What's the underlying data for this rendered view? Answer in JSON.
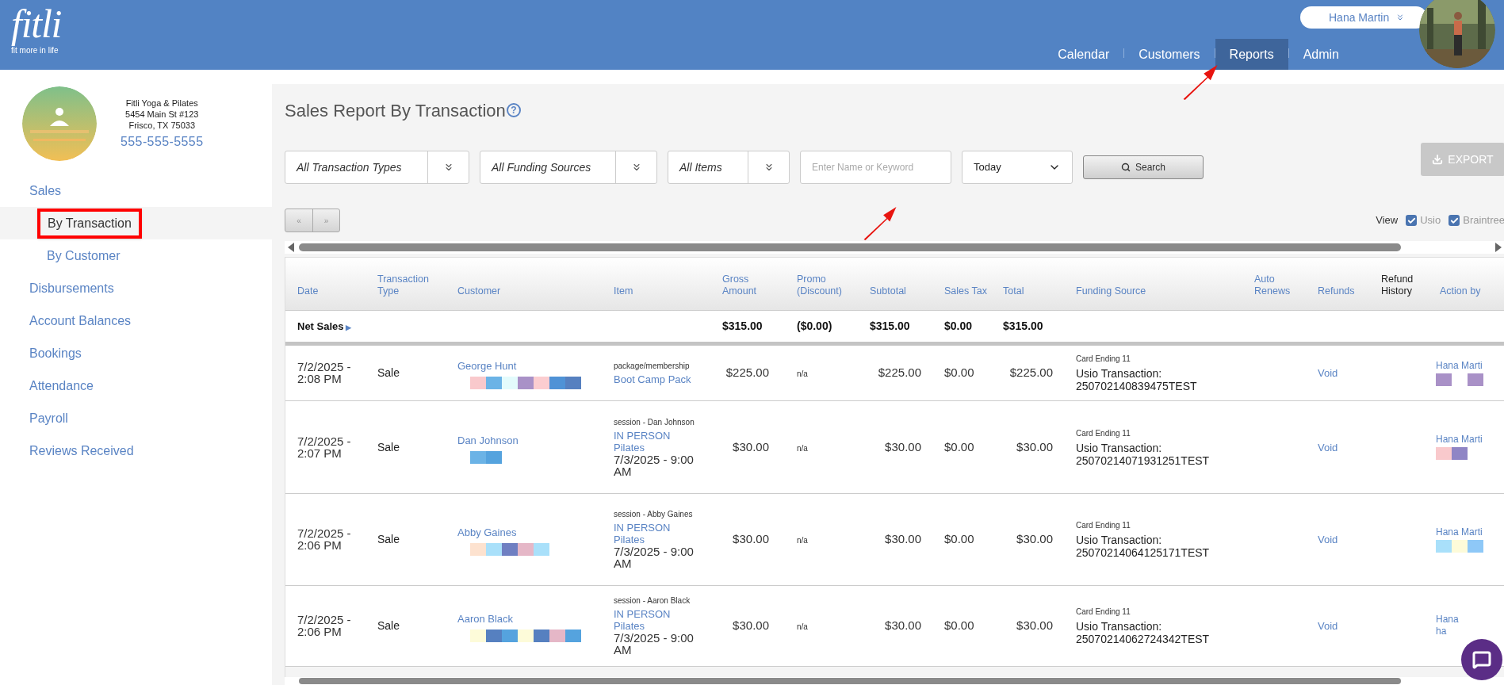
{
  "header": {
    "logo": "fitli",
    "tagline": "fit more in life",
    "user_name": "Hana Martin",
    "nav": [
      {
        "label": "Calendar",
        "selected": false
      },
      {
        "label": "Customers",
        "selected": false
      },
      {
        "label": "Reports",
        "selected": true
      },
      {
        "label": "Admin",
        "selected": false
      }
    ]
  },
  "sidebar": {
    "business": {
      "name": "Fitli Yoga & Pilates",
      "address": "5454 Main St #123",
      "city": "Frisco, TX 75033",
      "phone": "555-555-5555"
    },
    "items": [
      {
        "label": "Sales",
        "selected": false,
        "children": [
          {
            "label": "By Transaction",
            "selected": true
          },
          {
            "label": "By Customer",
            "selected": false
          }
        ]
      },
      {
        "label": "Disbursements",
        "selected": false
      },
      {
        "label": "Account Balances",
        "selected": false
      },
      {
        "label": "Bookings",
        "selected": false
      },
      {
        "label": "Attendance",
        "selected": false
      },
      {
        "label": "Payroll",
        "selected": false
      },
      {
        "label": "Reviews Received",
        "selected": false
      }
    ]
  },
  "page": {
    "title": "Sales Report By Transaction",
    "help_icon": "?",
    "filters": [
      {
        "kind": "dropdown",
        "value": "All Transaction Types"
      },
      {
        "kind": "dropdown",
        "value": "All Funding Sources"
      },
      {
        "kind": "dropdown",
        "value": "All Items"
      },
      {
        "kind": "input",
        "placeholder": "Enter Name or Keyword"
      },
      {
        "kind": "select",
        "value": "Today"
      }
    ],
    "search_button": "Search",
    "export_button": {
      "label": "EXPORT",
      "disabled": true
    },
    "pager": [
      "«",
      "»"
    ],
    "view": {
      "label": "View",
      "options": [
        {
          "label": "Usio",
          "checked": true
        },
        {
          "label": "Braintree",
          "checked": true
        }
      ]
    }
  },
  "table": {
    "columns": [
      {
        "label": "Date",
        "sortable": true
      },
      {
        "label": "Transaction Type",
        "sortable": true
      },
      {
        "label": "Customer",
        "sortable": true
      },
      {
        "label": "Item",
        "sortable": true
      },
      {
        "label": "Gross Amount",
        "sortable": true
      },
      {
        "label": "Promo (Discount)",
        "sortable": true
      },
      {
        "label": "Subtotal",
        "sortable": true
      },
      {
        "label": "Sales Tax",
        "sortable": true
      },
      {
        "label": "Total",
        "sortable": true
      },
      {
        "label": "Funding Source",
        "sortable": true
      },
      {
        "label": "Auto Renews",
        "sortable": true
      },
      {
        "label": "Refunds",
        "sortable": true
      },
      {
        "label": "Refund History",
        "sortable": false
      },
      {
        "label": "Action by",
        "sortable": true
      }
    ],
    "net_sales": {
      "label": "Net Sales",
      "toggle": "▶",
      "gross": "$315.00",
      "promo": "($0.00)",
      "subtotal": "$315.00",
      "tax": "$0.00",
      "total": "$315.00"
    },
    "rows": [
      {
        "date": "7/2/2025 - 2:08 PM",
        "type": "Sale",
        "customer": "George Hunt",
        "item_note": "package/membership",
        "item": "Boot Camp Pack",
        "gross": "$225.00",
        "promo": "n/a",
        "subtotal": "$225.00",
        "tax": "$0.00",
        "total": "$225.00",
        "card": "Card Ending 11",
        "transaction": "Usio Transaction: 250702140839475TEST",
        "refund": "Void",
        "action_by": [
          "Hana Marti"
        ]
      },
      {
        "date": "7/2/2025 - 2:07 PM",
        "type": "Sale",
        "customer": "Dan Johnson",
        "item_note": "session - Dan Johnson",
        "item": "IN PERSON Pilates",
        "item_time": "7/3/2025 - 9:00 AM",
        "gross": "$30.00",
        "promo": "n/a",
        "subtotal": "$30.00",
        "tax": "$0.00",
        "total": "$30.00",
        "card": "Card Ending 11",
        "transaction": "Usio Transaction: 25070214071931251TEST",
        "refund": "Void",
        "action_by": [
          "Hana Marti"
        ]
      },
      {
        "date": "7/2/2025 - 2:06 PM",
        "type": "Sale",
        "customer": "Abby Gaines",
        "item_note": "session - Abby Gaines",
        "item": "IN PERSON Pilates",
        "item_time": "7/3/2025 - 9:00 AM",
        "gross": "$30.00",
        "promo": "n/a",
        "subtotal": "$30.00",
        "tax": "$0.00",
        "total": "$30.00",
        "card": "Card Ending 11",
        "transaction": "Usio Transaction: 25070214064125171TEST",
        "refund": "Void",
        "action_by": [
          "Hana Marti"
        ]
      },
      {
        "date": "7/2/2025 - 2:06 PM",
        "type": "Sale",
        "customer": "Aaron Black",
        "item_note": "session - Aaron Black",
        "item": "IN PERSON Pilates",
        "item_time": "7/3/2025 - 9:00 AM",
        "gross": "$30.00",
        "promo": "n/a",
        "subtotal": "$30.00",
        "tax": "$0.00",
        "total": "$30.00",
        "card": "Card Ending 11",
        "transaction": "Usio Transaction: 25070214062724342TEST",
        "refund": "Void",
        "action_by": [
          "Hana",
          "ha"
        ]
      }
    ]
  }
}
